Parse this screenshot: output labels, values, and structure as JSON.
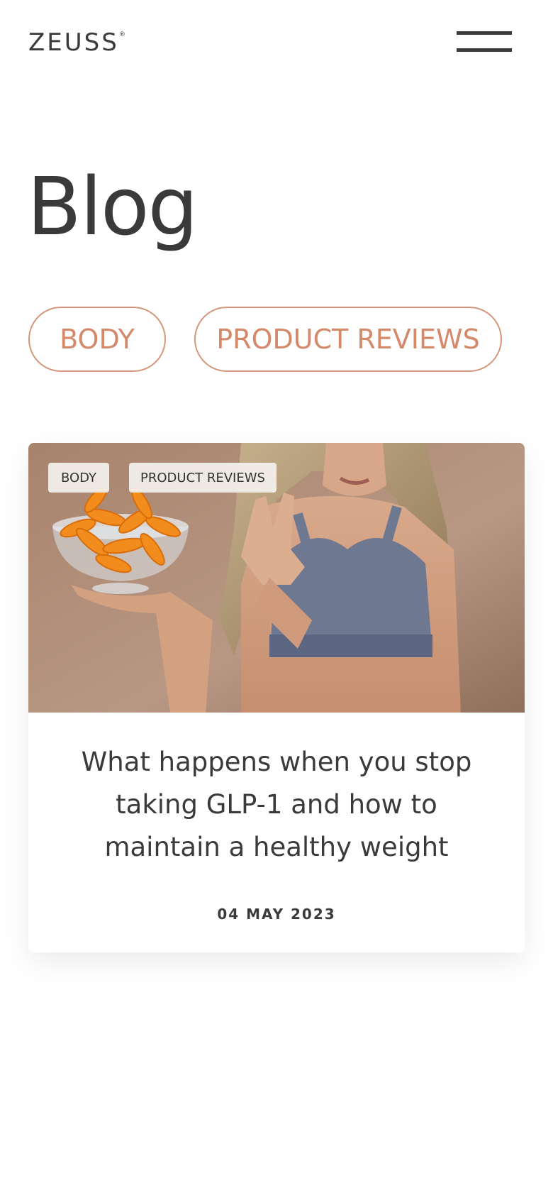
{
  "header": {
    "logo_text": "ZEUSS",
    "logo_mark": "®",
    "menu_icon": "hamburger-menu-icon"
  },
  "page": {
    "title": "Blog"
  },
  "filters": [
    {
      "label": "BODY"
    },
    {
      "label": "PRODUCT REVIEWS"
    }
  ],
  "posts": [
    {
      "tags": [
        "BODY",
        "PRODUCT REVIEWS"
      ],
      "title": "What happens when you stop taking GLP-1 and how to maintain a healthy weight",
      "date": "04 MAY 2023",
      "image": "woman holding a bowl of cheese puffs while gesturing no"
    }
  ],
  "colors": {
    "accent": "#d4896b",
    "accent_border": "#d4967a",
    "text": "#3a3a3a",
    "background": "#ffffff",
    "tag_background": "#f2eeea",
    "image_background": "#b08e78"
  }
}
